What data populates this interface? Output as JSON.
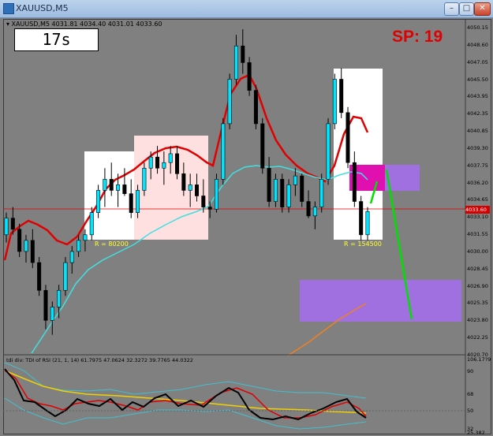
{
  "window": {
    "title": "XAUUSD,M5",
    "min_label": "–",
    "max_label": "□",
    "close_label": "✕"
  },
  "chart_header": "▾ XAUUSD,M5  4031.81 4034.40 4031.01 4033.60",
  "timer": "17s",
  "spread": "SP: 19",
  "price_ticks": [
    "4050.15",
    "4048.60",
    "4047.05",
    "4045.50",
    "4043.95",
    "4042.35",
    "4040.85",
    "4039.30",
    "4037.75",
    "4036.20",
    "4034.65",
    "4033.10",
    "4031.55",
    "4030.00",
    "4028.45",
    "4026.90",
    "4025.35",
    "4023.80",
    "4022.25",
    "4020.70"
  ],
  "current_price": "4033.60",
  "ranges": [
    {
      "label": "R = 80200"
    },
    {
      "label": "R = 154500"
    }
  ],
  "indicator": {
    "header": "tdi div: TDI of RSI  (21, 1, 14)  61.7975  47.0624  32.3272  39.7765  44.0322",
    "ticks": [
      "106.17?9",
      "90",
      "68",
      "50",
      "32",
      "25.382"
    ]
  },
  "colors": {
    "bg": "#808080",
    "bull": "#00e5ff",
    "bear": "#000000",
    "ma_red": "#e00000",
    "ma_cyan": "#40e0e0",
    "ma_orange": "#f08020",
    "zone_purple": "#a070e0",
    "zone_magenta": "#e010b0",
    "arrow_green": "#00e000",
    "range_white": "#ffffff",
    "range_pink": "#ffe0e0"
  },
  "chart_data": {
    "type": "candlestick",
    "symbol": "XAUUSD",
    "timeframe": "M5",
    "ylim": [
      4020.7,
      4050.15
    ],
    "candles": [
      [
        4031.5,
        4033.5,
        4030.8,
        4033.0
      ],
      [
        4033.0,
        4034.0,
        4031.5,
        4032.0
      ],
      [
        4032.0,
        4032.5,
        4029.5,
        4030.0
      ],
      [
        4030.0,
        4031.5,
        4029.0,
        4031.0
      ],
      [
        4031.0,
        4032.0,
        4028.5,
        4029.0
      ],
      [
        4029.0,
        4029.5,
        4026.0,
        4026.5
      ],
      [
        4026.5,
        4027.0,
        4023.0,
        4023.8
      ],
      [
        4023.8,
        4025.5,
        4022.5,
        4025.0
      ],
      [
        4025.0,
        4027.0,
        4024.0,
        4026.5
      ],
      [
        4026.5,
        4029.5,
        4026.0,
        4029.0
      ],
      [
        4029.0,
        4030.5,
        4028.0,
        4030.0
      ],
      [
        4030.0,
        4031.5,
        4029.5,
        4031.0
      ],
      [
        4031.0,
        4032.0,
        4030.0,
        4031.5
      ],
      [
        4031.5,
        4034.0,
        4031.0,
        4033.5
      ],
      [
        4033.5,
        4036.0,
        4033.0,
        4035.5
      ],
      [
        4035.5,
        4037.5,
        4034.0,
        4036.5
      ],
      [
        4036.5,
        4038.0,
        4035.0,
        4035.5
      ],
      [
        4035.5,
        4037.0,
        4034.0,
        4036.0
      ],
      [
        4036.0,
        4037.5,
        4035.0,
        4035.2
      ],
      [
        4035.2,
        4036.5,
        4033.0,
        4033.5
      ],
      [
        4033.5,
        4036.0,
        4033.0,
        4035.5
      ],
      [
        4035.5,
        4038.0,
        4035.0,
        4037.5
      ],
      [
        4037.5,
        4039.0,
        4036.5,
        4038.5
      ],
      [
        4038.5,
        4039.5,
        4037.0,
        4037.5
      ],
      [
        4037.5,
        4039.0,
        4036.0,
        4038.0
      ],
      [
        4038.0,
        4039.5,
        4037.0,
        4038.8
      ],
      [
        4038.8,
        4039.5,
        4036.5,
        4037.0
      ],
      [
        4037.0,
        4038.0,
        4035.0,
        4035.5
      ],
      [
        4035.5,
        4037.0,
        4034.0,
        4036.0
      ],
      [
        4036.0,
        4037.0,
        4034.5,
        4035.0
      ],
      [
        4035.0,
        4036.5,
        4033.5,
        4034.0
      ],
      [
        4034.0,
        4034.5,
        4033.0,
        4033.8
      ],
      [
        4033.8,
        4037.0,
        4033.5,
        4036.5
      ],
      [
        4036.5,
        4042.0,
        4036.0,
        4041.5
      ],
      [
        4041.5,
        4046.0,
        4041.0,
        4045.5
      ],
      [
        4045.5,
        4049.5,
        4045.0,
        4048.5
      ],
      [
        4048.5,
        4050.0,
        4046.0,
        4047.0
      ],
      [
        4047.0,
        4047.5,
        4044.0,
        4044.5
      ],
      [
        4044.5,
        4045.0,
        4041.0,
        4041.5
      ],
      [
        4041.5,
        4042.0,
        4037.0,
        4037.5
      ],
      [
        4037.5,
        4038.5,
        4034.0,
        4034.5
      ],
      [
        4034.5,
        4037.0,
        4034.0,
        4036.5
      ],
      [
        4036.5,
        4037.0,
        4033.5,
        4034.0
      ],
      [
        4034.0,
        4036.5,
        4033.5,
        4036.0
      ],
      [
        4036.0,
        4037.5,
        4035.0,
        4036.8
      ],
      [
        4036.8,
        4037.0,
        4034.0,
        4034.5
      ],
      [
        4034.5,
        4035.5,
        4033.0,
        4033.2
      ],
      [
        4033.2,
        4034.5,
        4032.0,
        4034.0
      ],
      [
        4034.0,
        4037.0,
        4033.5,
        4036.5
      ],
      [
        4036.5,
        4042.0,
        4036.0,
        4041.5
      ],
      [
        4041.5,
        4046.0,
        4041.0,
        4045.5
      ],
      [
        4045.5,
        4046.5,
        4042.0,
        4042.5
      ],
      [
        4042.5,
        4043.0,
        4037.5,
        4038.0
      ],
      [
        4038.0,
        4039.0,
        4034.0,
        4034.5
      ],
      [
        4034.5,
        4035.0,
        4031.0,
        4031.5
      ],
      [
        4031.5,
        4034.0,
        4031.0,
        4033.6
      ]
    ]
  }
}
